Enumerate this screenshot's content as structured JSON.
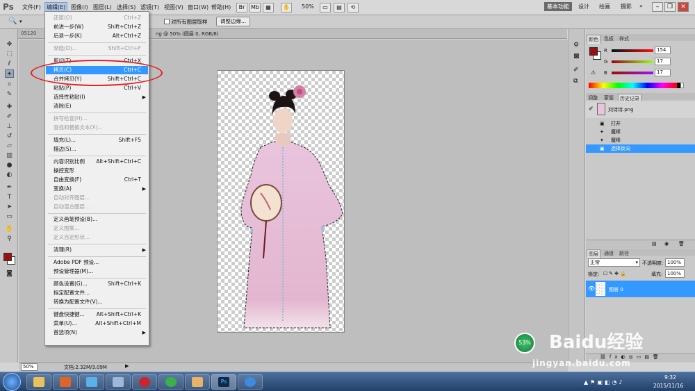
{
  "app": {
    "logo": "Ps",
    "accent": "#3399ff",
    "close_color": "#c8483c"
  },
  "menubar": {
    "items": [
      "文件(F)",
      "编辑(E)",
      "图像(I)",
      "图层(L)",
      "选择(S)",
      "滤镜(T)",
      "视图(V)",
      "窗口(W)",
      "帮助(H)"
    ],
    "zoom": "50%",
    "workspaces": [
      "基本功能",
      "设计",
      "绘画",
      "摄影"
    ],
    "more": "»"
  },
  "options_bar": {
    "checkbox_label": "对所有图层取样",
    "refine_button": "调整边缘..."
  },
  "doc_tab": {
    "left_fragment": "05120",
    "title_fragment": "ng @ 50% (图层 0, RGB/8)"
  },
  "edit_menu": {
    "items": [
      {
        "label": "还原(O)",
        "shortcut": "Ctrl+Z",
        "disabled": true
      },
      {
        "label": "前进一步(W)",
        "shortcut": "Shift+Ctrl+Z",
        "disabled": false
      },
      {
        "label": "后退一步(K)",
        "shortcut": "Alt+Ctrl+Z",
        "disabled": false
      },
      {
        "sep": true
      },
      {
        "label": "渐隐(D)...",
        "shortcut": "Shift+Ctrl+F",
        "disabled": true
      },
      {
        "sep": true
      },
      {
        "label": "剪切(T)",
        "shortcut": "Ctrl+X",
        "disabled": false
      },
      {
        "label": "拷贝(C)",
        "shortcut": "Ctrl+C",
        "disabled": false,
        "highlighted": true
      },
      {
        "label": "合并拷贝(Y)",
        "shortcut": "Shift+Ctrl+C",
        "disabled": false
      },
      {
        "label": "粘贴(P)",
        "shortcut": "Ctrl+V",
        "disabled": false
      },
      {
        "label": "选择性粘贴(I)",
        "shortcut": "",
        "submenu": true,
        "disabled": false
      },
      {
        "label": "清除(E)",
        "shortcut": "",
        "disabled": false
      },
      {
        "sep": true
      },
      {
        "label": "拼写检查(H)...",
        "shortcut": "",
        "disabled": true
      },
      {
        "label": "查找和替换文本(X)...",
        "shortcut": "",
        "disabled": true
      },
      {
        "sep": true
      },
      {
        "label": "填充(L)...",
        "shortcut": "Shift+F5",
        "disabled": false
      },
      {
        "label": "描边(S)...",
        "shortcut": "",
        "disabled": false
      },
      {
        "sep": true
      },
      {
        "label": "内容识别比例",
        "shortcut": "Alt+Shift+Ctrl+C",
        "disabled": false
      },
      {
        "label": "操控变形",
        "shortcut": "",
        "disabled": false
      },
      {
        "label": "自由变换(F)",
        "shortcut": "Ctrl+T",
        "disabled": false
      },
      {
        "label": "变换(A)",
        "shortcut": "",
        "submenu": true,
        "disabled": false
      },
      {
        "label": "自动对齐图层...",
        "shortcut": "",
        "disabled": true
      },
      {
        "label": "自动混合图层...",
        "shortcut": "",
        "disabled": true
      },
      {
        "sep": true
      },
      {
        "label": "定义画笔预设(B)...",
        "shortcut": "",
        "disabled": false
      },
      {
        "label": "定义图案...",
        "shortcut": "",
        "disabled": true
      },
      {
        "label": "定义自定形状...",
        "shortcut": "",
        "disabled": true
      },
      {
        "sep": true
      },
      {
        "label": "清理(R)",
        "shortcut": "",
        "submenu": true,
        "disabled": false
      },
      {
        "sep": true
      },
      {
        "label": "Adobe PDF 预设...",
        "shortcut": "",
        "disabled": false
      },
      {
        "label": "预设管理器(M)...",
        "shortcut": "",
        "disabled": false
      },
      {
        "sep": true
      },
      {
        "label": "颜色设置(G)...",
        "shortcut": "Shift+Ctrl+K",
        "disabled": false
      },
      {
        "label": "指定配置文件...",
        "shortcut": "",
        "disabled": false
      },
      {
        "label": "转换为配置文件(V)...",
        "shortcut": "",
        "disabled": false
      },
      {
        "sep": true
      },
      {
        "label": "键盘快捷键...",
        "shortcut": "Alt+Shift+Ctrl+K",
        "disabled": false
      },
      {
        "label": "菜单(U)...",
        "shortcut": "Alt+Shift+Ctrl+M",
        "disabled": false
      },
      {
        "label": "首选项(N)",
        "shortcut": "",
        "submenu": true,
        "disabled": false
      }
    ]
  },
  "color_panel": {
    "tabs": [
      "颜色",
      "色板",
      "样式"
    ],
    "r_label": "R",
    "g_label": "G",
    "b_label": "B",
    "r": "154",
    "g": "17",
    "b": "17",
    "fg_color": "#9a1111"
  },
  "history_panel": {
    "tabs": [
      "调整",
      "蒙版",
      "历史记录"
    ],
    "snapshot": "刘诗诗.png",
    "steps": [
      "打开",
      "魔棒",
      "魔棒",
      "选择反向"
    ]
  },
  "layers_panel": {
    "tabs": [
      "图层",
      "通道",
      "路径"
    ],
    "blend_mode": "正常",
    "opacity_label": "不透明度:",
    "opacity": "100%",
    "lock_label": "锁定:",
    "fill_label": "填充:",
    "fill": "100%",
    "layer_name": "图层 0"
  },
  "status": {
    "zoom": "50%",
    "doc_info": "文档:2.32M/3.09M"
  },
  "overlay": {
    "percent": "53%",
    "wm_logo": "Baidu经验",
    "wm_url": "jingyan.baidu.com"
  },
  "taskbar": {
    "time": "9:32",
    "date": "2015/11/16"
  }
}
